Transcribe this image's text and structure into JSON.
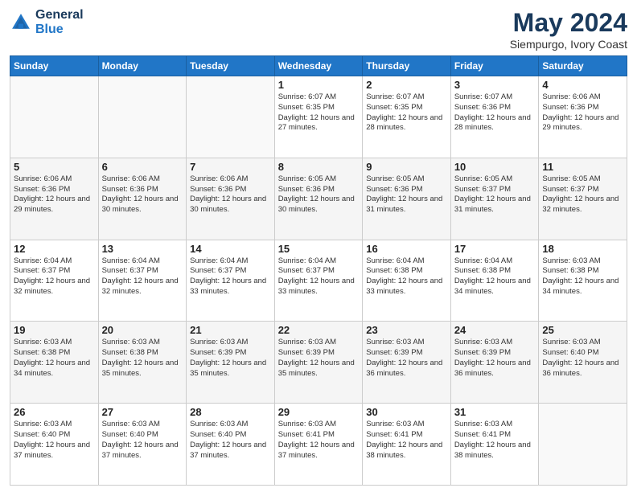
{
  "header": {
    "logo_line1": "General",
    "logo_line2": "Blue",
    "title": "May 2024",
    "subtitle": "Siempurgo, Ivory Coast"
  },
  "calendar": {
    "days_of_week": [
      "Sunday",
      "Monday",
      "Tuesday",
      "Wednesday",
      "Thursday",
      "Friday",
      "Saturday"
    ],
    "weeks": [
      [
        {
          "day": "",
          "sunrise": "",
          "sunset": "",
          "daylight": ""
        },
        {
          "day": "",
          "sunrise": "",
          "sunset": "",
          "daylight": ""
        },
        {
          "day": "",
          "sunrise": "",
          "sunset": "",
          "daylight": ""
        },
        {
          "day": "1",
          "sunrise": "Sunrise: 6:07 AM",
          "sunset": "Sunset: 6:35 PM",
          "daylight": "Daylight: 12 hours and 27 minutes."
        },
        {
          "day": "2",
          "sunrise": "Sunrise: 6:07 AM",
          "sunset": "Sunset: 6:35 PM",
          "daylight": "Daylight: 12 hours and 28 minutes."
        },
        {
          "day": "3",
          "sunrise": "Sunrise: 6:07 AM",
          "sunset": "Sunset: 6:36 PM",
          "daylight": "Daylight: 12 hours and 28 minutes."
        },
        {
          "day": "4",
          "sunrise": "Sunrise: 6:06 AM",
          "sunset": "Sunset: 6:36 PM",
          "daylight": "Daylight: 12 hours and 29 minutes."
        }
      ],
      [
        {
          "day": "5",
          "sunrise": "Sunrise: 6:06 AM",
          "sunset": "Sunset: 6:36 PM",
          "daylight": "Daylight: 12 hours and 29 minutes."
        },
        {
          "day": "6",
          "sunrise": "Sunrise: 6:06 AM",
          "sunset": "Sunset: 6:36 PM",
          "daylight": "Daylight: 12 hours and 30 minutes."
        },
        {
          "day": "7",
          "sunrise": "Sunrise: 6:06 AM",
          "sunset": "Sunset: 6:36 PM",
          "daylight": "Daylight: 12 hours and 30 minutes."
        },
        {
          "day": "8",
          "sunrise": "Sunrise: 6:05 AM",
          "sunset": "Sunset: 6:36 PM",
          "daylight": "Daylight: 12 hours and 30 minutes."
        },
        {
          "day": "9",
          "sunrise": "Sunrise: 6:05 AM",
          "sunset": "Sunset: 6:36 PM",
          "daylight": "Daylight: 12 hours and 31 minutes."
        },
        {
          "day": "10",
          "sunrise": "Sunrise: 6:05 AM",
          "sunset": "Sunset: 6:37 PM",
          "daylight": "Daylight: 12 hours and 31 minutes."
        },
        {
          "day": "11",
          "sunrise": "Sunrise: 6:05 AM",
          "sunset": "Sunset: 6:37 PM",
          "daylight": "Daylight: 12 hours and 32 minutes."
        }
      ],
      [
        {
          "day": "12",
          "sunrise": "Sunrise: 6:04 AM",
          "sunset": "Sunset: 6:37 PM",
          "daylight": "Daylight: 12 hours and 32 minutes."
        },
        {
          "day": "13",
          "sunrise": "Sunrise: 6:04 AM",
          "sunset": "Sunset: 6:37 PM",
          "daylight": "Daylight: 12 hours and 32 minutes."
        },
        {
          "day": "14",
          "sunrise": "Sunrise: 6:04 AM",
          "sunset": "Sunset: 6:37 PM",
          "daylight": "Daylight: 12 hours and 33 minutes."
        },
        {
          "day": "15",
          "sunrise": "Sunrise: 6:04 AM",
          "sunset": "Sunset: 6:37 PM",
          "daylight": "Daylight: 12 hours and 33 minutes."
        },
        {
          "day": "16",
          "sunrise": "Sunrise: 6:04 AM",
          "sunset": "Sunset: 6:38 PM",
          "daylight": "Daylight: 12 hours and 33 minutes."
        },
        {
          "day": "17",
          "sunrise": "Sunrise: 6:04 AM",
          "sunset": "Sunset: 6:38 PM",
          "daylight": "Daylight: 12 hours and 34 minutes."
        },
        {
          "day": "18",
          "sunrise": "Sunrise: 6:03 AM",
          "sunset": "Sunset: 6:38 PM",
          "daylight": "Daylight: 12 hours and 34 minutes."
        }
      ],
      [
        {
          "day": "19",
          "sunrise": "Sunrise: 6:03 AM",
          "sunset": "Sunset: 6:38 PM",
          "daylight": "Daylight: 12 hours and 34 minutes."
        },
        {
          "day": "20",
          "sunrise": "Sunrise: 6:03 AM",
          "sunset": "Sunset: 6:38 PM",
          "daylight": "Daylight: 12 hours and 35 minutes."
        },
        {
          "day": "21",
          "sunrise": "Sunrise: 6:03 AM",
          "sunset": "Sunset: 6:39 PM",
          "daylight": "Daylight: 12 hours and 35 minutes."
        },
        {
          "day": "22",
          "sunrise": "Sunrise: 6:03 AM",
          "sunset": "Sunset: 6:39 PM",
          "daylight": "Daylight: 12 hours and 35 minutes."
        },
        {
          "day": "23",
          "sunrise": "Sunrise: 6:03 AM",
          "sunset": "Sunset: 6:39 PM",
          "daylight": "Daylight: 12 hours and 36 minutes."
        },
        {
          "day": "24",
          "sunrise": "Sunrise: 6:03 AM",
          "sunset": "Sunset: 6:39 PM",
          "daylight": "Daylight: 12 hours and 36 minutes."
        },
        {
          "day": "25",
          "sunrise": "Sunrise: 6:03 AM",
          "sunset": "Sunset: 6:40 PM",
          "daylight": "Daylight: 12 hours and 36 minutes."
        }
      ],
      [
        {
          "day": "26",
          "sunrise": "Sunrise: 6:03 AM",
          "sunset": "Sunset: 6:40 PM",
          "daylight": "Daylight: 12 hours and 37 minutes."
        },
        {
          "day": "27",
          "sunrise": "Sunrise: 6:03 AM",
          "sunset": "Sunset: 6:40 PM",
          "daylight": "Daylight: 12 hours and 37 minutes."
        },
        {
          "day": "28",
          "sunrise": "Sunrise: 6:03 AM",
          "sunset": "Sunset: 6:40 PM",
          "daylight": "Daylight: 12 hours and 37 minutes."
        },
        {
          "day": "29",
          "sunrise": "Sunrise: 6:03 AM",
          "sunset": "Sunset: 6:41 PM",
          "daylight": "Daylight: 12 hours and 37 minutes."
        },
        {
          "day": "30",
          "sunrise": "Sunrise: 6:03 AM",
          "sunset": "Sunset: 6:41 PM",
          "daylight": "Daylight: 12 hours and 38 minutes."
        },
        {
          "day": "31",
          "sunrise": "Sunrise: 6:03 AM",
          "sunset": "Sunset: 6:41 PM",
          "daylight": "Daylight: 12 hours and 38 minutes."
        },
        {
          "day": "",
          "sunrise": "",
          "sunset": "",
          "daylight": ""
        }
      ]
    ]
  }
}
